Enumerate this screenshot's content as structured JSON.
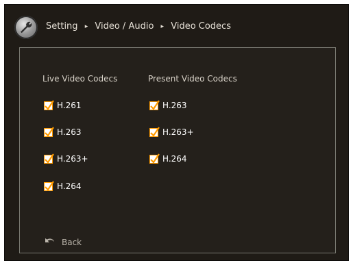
{
  "header": {
    "breadcrumb": [
      "Setting",
      "Video / Audio",
      "Video Codecs"
    ],
    "separator": "▸",
    "icon": "wrench-icon"
  },
  "live_video_codecs": {
    "title": "Live Video Codecs",
    "items": [
      {
        "label": "H.261",
        "checked": true
      },
      {
        "label": "H.263",
        "checked": true
      },
      {
        "label": "H.263+",
        "checked": true
      },
      {
        "label": "H.264",
        "checked": true
      }
    ]
  },
  "present_video_codecs": {
    "title": "Present Video Codecs",
    "items": [
      {
        "label": "H.263",
        "checked": true
      },
      {
        "label": "H.263+",
        "checked": true
      },
      {
        "label": "H.264",
        "checked": true
      }
    ]
  },
  "footer": {
    "back_label": "Back"
  },
  "colors": {
    "background": "#1f1b16",
    "accent": "#ff9b00",
    "text": "#e7e1d7"
  }
}
